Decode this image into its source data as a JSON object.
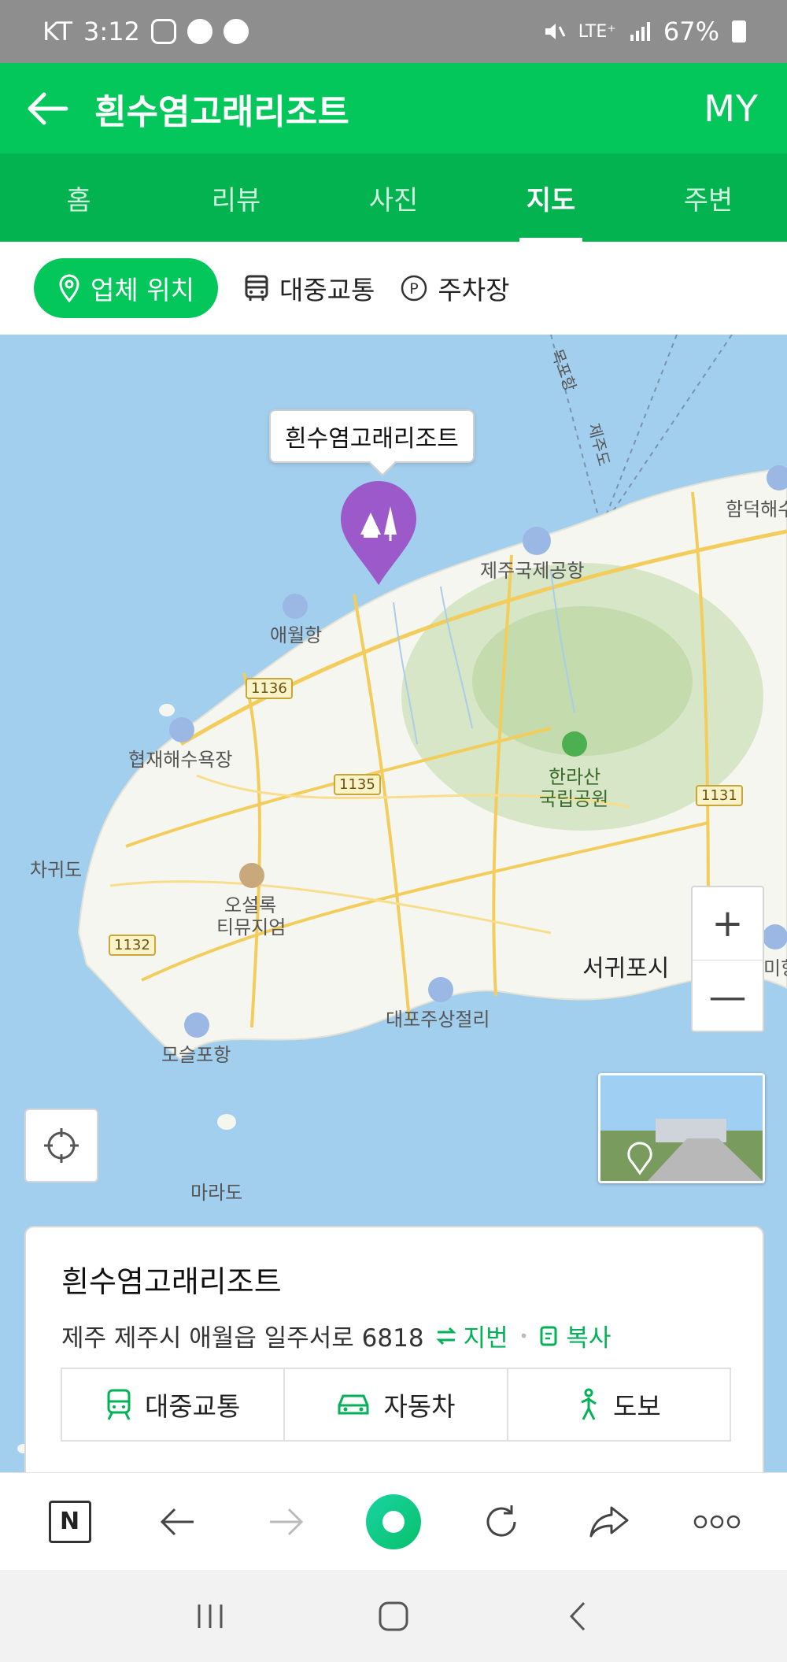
{
  "status_bar": {
    "carrier": "KT",
    "time": "3:12",
    "battery": "67%",
    "network": "LTE⁺"
  },
  "header": {
    "title": "흰수염고래리조트",
    "my_label": "MY"
  },
  "tabs": [
    {
      "label": "홈"
    },
    {
      "label": "리뷰"
    },
    {
      "label": "사진"
    },
    {
      "label": "지도",
      "active": true
    },
    {
      "label": "주변"
    }
  ],
  "filters": {
    "location": "업체 위치",
    "transit": "대중교통",
    "parking": "주차장"
  },
  "map": {
    "callout": "흰수염고래리조트",
    "labels": {
      "airport": "제주국제공항",
      "aewol_port": "애월항",
      "hyeopjae": "협재해수욕장",
      "hallasan_1": "한라산",
      "hallasan_2": "국립공원",
      "chagwido": "차귀도",
      "osulloc_1": "오설록",
      "osulloc_2": "티뮤지엄",
      "seogwipo": "서귀포시",
      "daepo": "대포주상절리",
      "moseulpo": "모슬포항",
      "marado": "마라도",
      "hamdeok": "함덕해수",
      "route_1": "목포항",
      "route_2": "제주도",
      "edge_label": "미항"
    },
    "road_badges": [
      "1136",
      "1135",
      "1131",
      "1132"
    ],
    "zoom_in": "+",
    "zoom_out": "—"
  },
  "info_card": {
    "name": "흰수염고래리조트",
    "address": "제주 제주시 애월읍 일주서로 6818",
    "jibeon": "지번",
    "copy": "복사",
    "routes": {
      "transit": "대중교통",
      "car": "자동차",
      "walk": "도보"
    }
  },
  "browser": {
    "home_label": "N"
  },
  "colors": {
    "brand_green": "#03c75a",
    "tab_green": "#02b350",
    "pin_purple": "#9b59c9",
    "sea": "#a3cfee"
  }
}
